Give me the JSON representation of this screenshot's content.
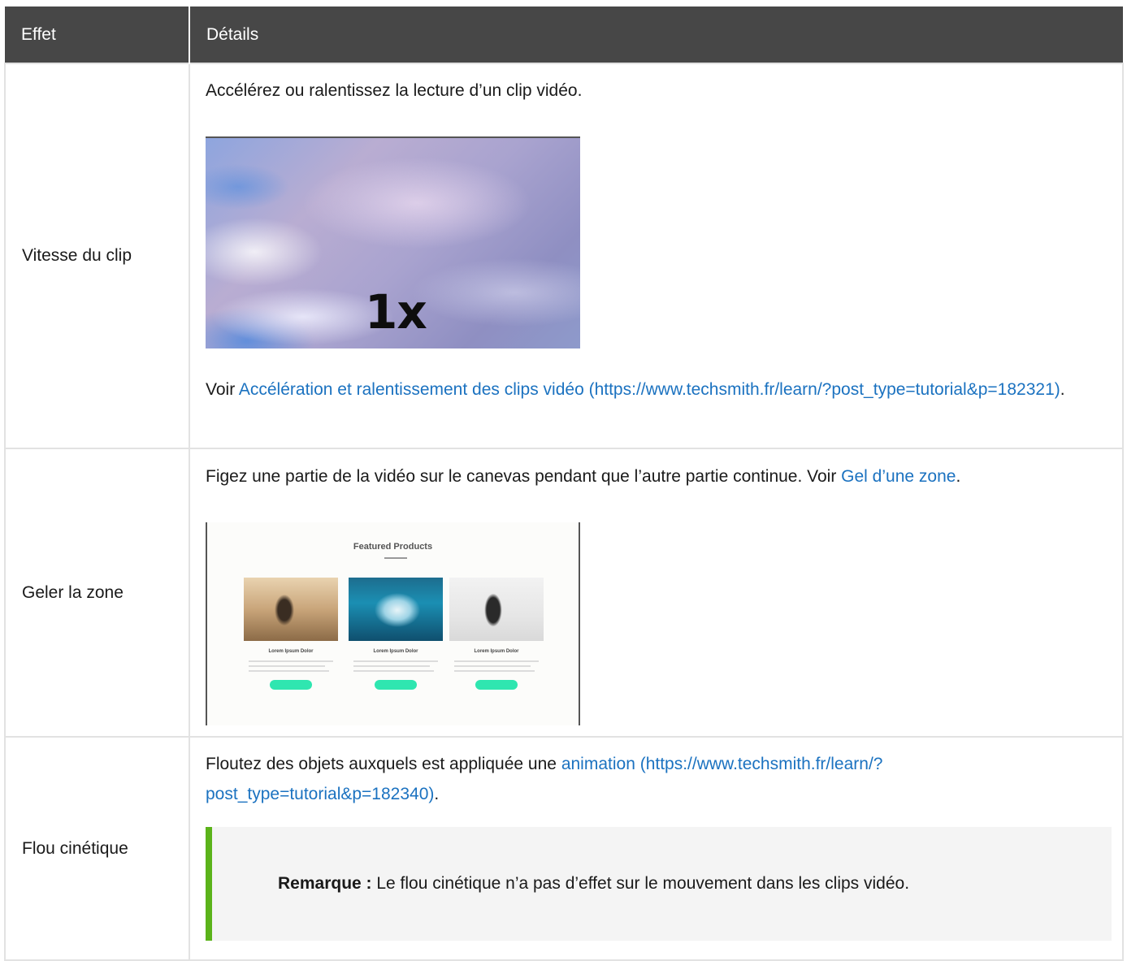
{
  "table": {
    "header": {
      "effect": "Effet",
      "details": "Détails"
    },
    "rows": [
      {
        "effect": "Vitesse du clip",
        "description": "Accélérez ou ralentissez la lecture d’un clip vidéo.",
        "image_label": "1x",
        "see_prefix": "Voir ",
        "link_text": "Accélération et ralentissement des clips vidéo (https://www.techsmith.fr/learn/?post_type=tutorial&p=182321)",
        "suffix": "."
      },
      {
        "effect": "Geler la zone",
        "description": "Figez une partie de la vidéo sur le canevas pendant que l’autre partie continue. Voir ",
        "link_text": "Gel d’une zone",
        "suffix": ".",
        "image": {
          "title": "Featured Products",
          "cards": [
            {
              "caption": "Lorem Ipsum Dolor"
            },
            {
              "caption": "Lorem Ipsum Dolor"
            },
            {
              "caption": "Lorem Ipsum Dolor"
            }
          ]
        }
      },
      {
        "effect": "Flou cinétique",
        "description": "Floutez des objets auxquels est appliquée une ",
        "link_text": "animation (https://www.techsmith.fr/learn/?post_type=tutorial&p=182340)",
        "suffix": ".",
        "note": {
          "label": "Remarque :",
          "text": " Le flou cinétique n’a pas d’effet sur le mouvement dans les clips vidéo.",
          "accent_color": "#5bb31a"
        }
      }
    ]
  },
  "colors": {
    "header_bg": "#474747",
    "link": "#1b72c0",
    "border": "#e2e2e2"
  }
}
